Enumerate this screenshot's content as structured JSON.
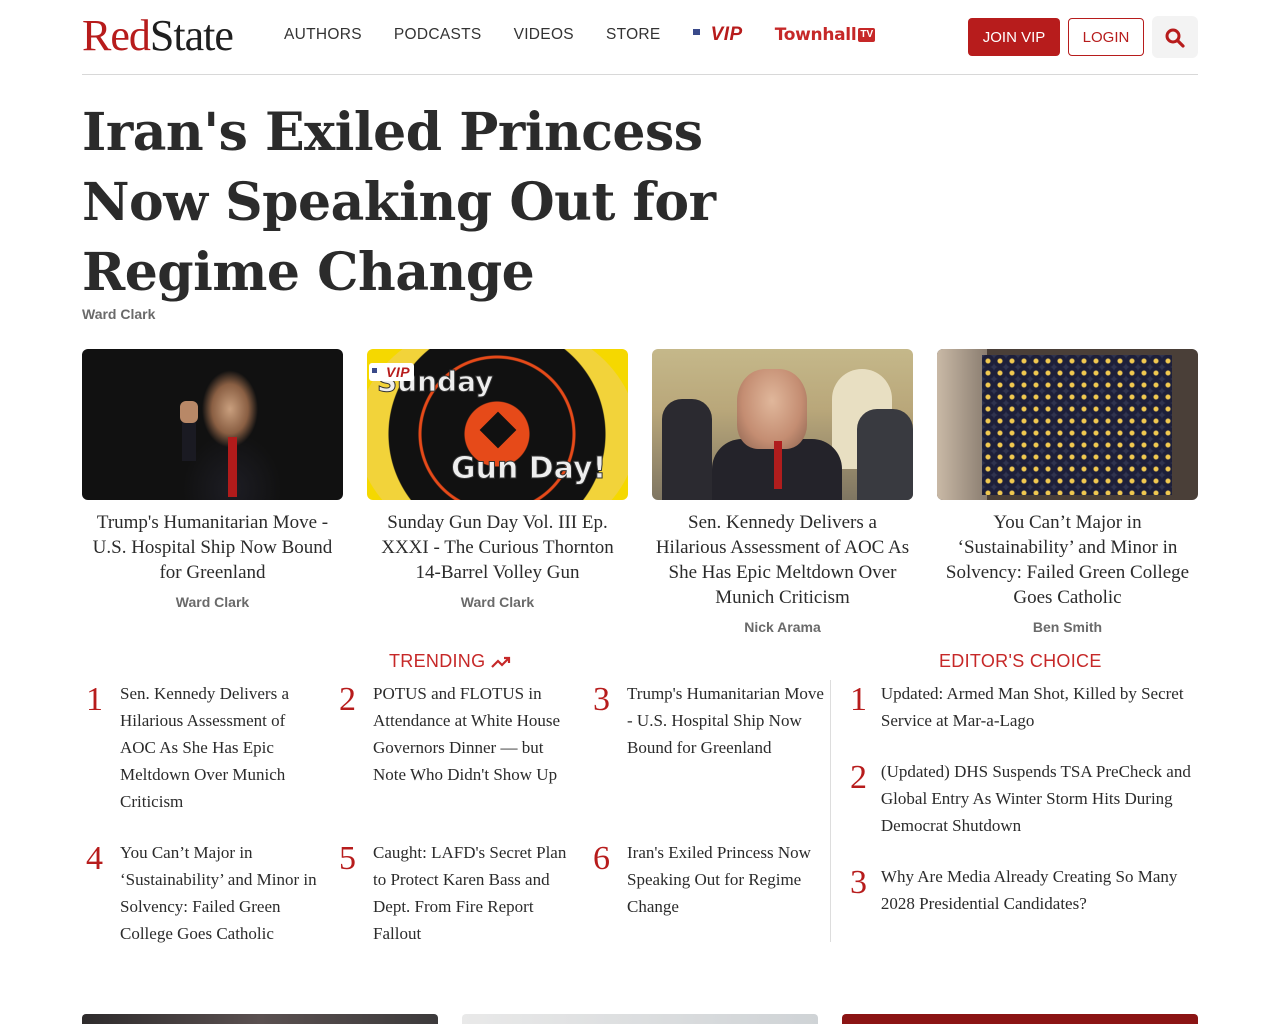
{
  "header": {
    "logo": {
      "red": "Red",
      "dark": "State"
    },
    "nav": [
      "AUTHORS",
      "PODCASTS",
      "VIDEOS",
      "STORE"
    ],
    "vip_label": "VIP",
    "townhall_label": "Townhall",
    "townhall_tv": "TV",
    "join_label": "JOIN VIP",
    "login_label": "LOGIN",
    "search_icon": "search-icon"
  },
  "main_article": {
    "title": "Iran's Exiled Princess Now Speaking Out for Regime Change",
    "author": "Ward Clark"
  },
  "cards": [
    {
      "title": "Trump's Humanitarian Move - U.S. Hospital Ship Now Bound for Greenland",
      "author": "Ward Clark"
    },
    {
      "title": "Sunday Gun Day Vol. III Ep. XXXI - The Curious Thornton 14-Barrel Volley Gun",
      "author": "Ward Clark",
      "image_text_1": "Sunday",
      "image_text_2": "Gun Day!",
      "badge": "VIP"
    },
    {
      "title": "Sen. Kennedy Delivers a Hilarious Assessment of AOC As She Has Epic Meltdown Over Munich Criticism",
      "author": "Nick Arama"
    },
    {
      "title": "You Can’t Major in ‘Sustainability’ and Minor in Solvency: Failed Green College Goes Catholic",
      "author": "Ben Smith"
    }
  ],
  "trending": {
    "title": "TRENDING",
    "items": [
      {
        "num": "1",
        "text": "Sen. Kennedy Delivers a Hilarious Assessment of AOC As She Has Epic Meltdown Over Munich Criticism"
      },
      {
        "num": "2",
        "text": "POTUS and FLOTUS in Attendance at White House Governors Dinner — but Note Who Didn't Show Up"
      },
      {
        "num": "3",
        "text": "Trump's Humanitarian Move - U.S. Hospital Ship Now Bound for Greenland"
      },
      {
        "num": "4",
        "text": "You Can’t Major in ‘Sustainability’ and Minor in Solvency: Failed Green College Goes Catholic"
      },
      {
        "num": "5",
        "text": "Caught: LAFD's Secret Plan to Protect Karen Bass and Dept. From Fire Report Fallout"
      },
      {
        "num": "6",
        "text": "Iran's Exiled Princess Now Speaking Out for Regime Change"
      }
    ]
  },
  "editors_choice": {
    "title": "EDITOR'S CHOICE",
    "items": [
      {
        "num": "1",
        "text": "Updated: Armed Man Shot, Killed by Secret Service at Mar-a-Lago"
      },
      {
        "num": "2",
        "text": "(Updated) DHS Suspends TSA PreCheck and Global Entry As Winter Storm Hits During Democrat Shutdown"
      },
      {
        "num": "3",
        "text": "Why Are Media Already Creating So Many 2028 Presidential Candidates?"
      }
    ]
  },
  "colors": {
    "brand_red": "#b71c1c",
    "text": "#2b2b2b",
    "muted": "#6a6a6a"
  }
}
